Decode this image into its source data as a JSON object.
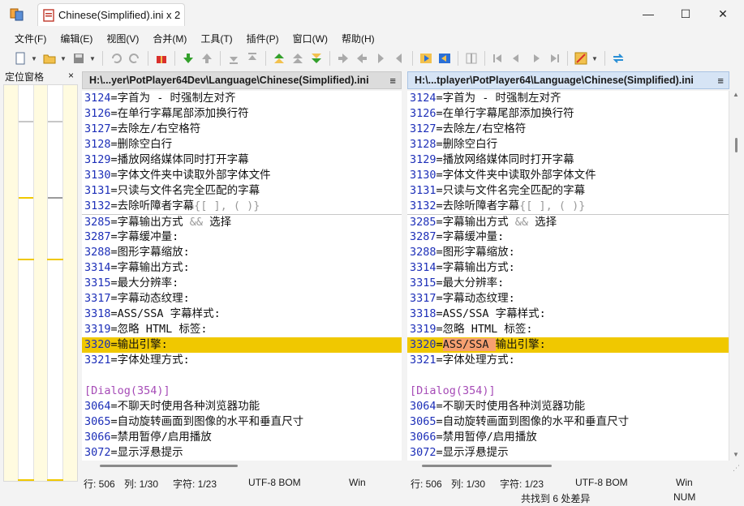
{
  "window": {
    "tab_title": "Chinese(Simplified).ini x 2",
    "minimize": "—",
    "maximize": "☐",
    "close": "✕"
  },
  "menu": [
    "文件(F)",
    "编辑(E)",
    "视图(V)",
    "合并(M)",
    "工具(T)",
    "插件(P)",
    "窗口(W)",
    "帮助(H)"
  ],
  "locator": {
    "title": "定位窗格",
    "close": "×",
    "accent_color": "#f0c800"
  },
  "left_pane": {
    "path": "H:\\...yer\\PotPlayer64Dev\\Language\\Chinese(Simplified).ini",
    "menu_glyph": "≡",
    "lines": [
      {
        "num": "3124",
        "text": "=字首为 - 时强制左对齐"
      },
      {
        "num": "3126",
        "text": "=在单行字幕尾部添加换行符"
      },
      {
        "num": "3127",
        "text": "=去除左/右空格符"
      },
      {
        "num": "3128",
        "text": "=删除空白行"
      },
      {
        "num": "3129",
        "text": "=播放网络媒体同时打开字幕"
      },
      {
        "num": "3130",
        "text": "=字体文件夹中读取外部字体文件"
      },
      {
        "num": "3131",
        "text": "=只读与文件名完全匹配的字幕"
      },
      {
        "num": "3132",
        "text": "=去除听障者字幕",
        "faint": "{[ ], ( )}"
      },
      {
        "num": "3285",
        "text": "=字幕输出方式 ",
        "faint": "&&",
        "tail": " 选择"
      },
      {
        "num": "3287",
        "text": "=字幕缓冲量:"
      },
      {
        "num": "3288",
        "text": "=图形字幕缩放:"
      },
      {
        "num": "3314",
        "text": "=字幕输出方式:"
      },
      {
        "num": "3315",
        "text": "=最大分辨率:"
      },
      {
        "num": "3317",
        "text": "=字幕动态纹理:"
      },
      {
        "num": "3318",
        "text": "=ASS/SSA 字幕样式:"
      },
      {
        "num": "3319",
        "text": "=忽略 HTML 标签:"
      },
      {
        "num": "3320",
        "text": "=输出引擎:"
      },
      {
        "num": "3321",
        "text": "=字体处理方式:"
      },
      {
        "num": "",
        "text": ""
      },
      {
        "num": "",
        "text": "[Dialog(354)]"
      },
      {
        "num": "3064",
        "text": "=不聊天时使用各种浏览器功能"
      },
      {
        "num": "3065",
        "text": "=自动旋转画面到图像的水平和垂直尺寸"
      },
      {
        "num": "3066",
        "text": "=禁用暂停/启用播放"
      },
      {
        "num": "3072",
        "text": "=显示浮悬提示"
      }
    ]
  },
  "right_pane": {
    "path": "H:\\...tplayer\\PotPlayer64\\Language\\Chinese(Simplified).ini",
    "menu_glyph": "≡",
    "lines": [
      {
        "num": "3124",
        "text": "=字首为 - 时强制左对齐"
      },
      {
        "num": "3126",
        "text": "=在单行字幕尾部添加换行符"
      },
      {
        "num": "3127",
        "text": "=去除左/右空格符"
      },
      {
        "num": "3128",
        "text": "=删除空白行"
      },
      {
        "num": "3129",
        "text": "=播放网络媒体同时打开字幕"
      },
      {
        "num": "3130",
        "text": "=字体文件夹中读取外部字体文件"
      },
      {
        "num": "3131",
        "text": "=只读与文件名完全匹配的字幕"
      },
      {
        "num": "3132",
        "text": "=去除听障者字幕",
        "faint": "{[ ], ( )}"
      },
      {
        "num": "3285",
        "text": "=字幕输出方式 ",
        "faint": "&&",
        "tail": " 选择"
      },
      {
        "num": "3287",
        "text": "=字幕缓冲量:"
      },
      {
        "num": "3288",
        "text": "=图形字幕缩放:"
      },
      {
        "num": "3314",
        "text": "=字幕输出方式:"
      },
      {
        "num": "3315",
        "text": "=最大分辨率:"
      },
      {
        "num": "3317",
        "text": "=字幕动态纹理:"
      },
      {
        "num": "3318",
        "text": "=ASS/SSA 字幕样式:"
      },
      {
        "num": "3319",
        "text": "=忽略 HTML 标签:"
      },
      {
        "num": "3320",
        "text": "=",
        "diff": "ASS/SSA ",
        "tail": "输出引擎:"
      },
      {
        "num": "3321",
        "text": "=字体处理方式:"
      },
      {
        "num": "",
        "text": ""
      },
      {
        "num": "",
        "text": "[Dialog(354)]"
      },
      {
        "num": "3064",
        "text": "=不聊天时使用各种浏览器功能"
      },
      {
        "num": "3065",
        "text": "=自动旋转画面到图像的水平和垂直尺寸"
      },
      {
        "num": "3066",
        "text": "=禁用暂停/启用播放"
      },
      {
        "num": "3072",
        "text": "=显示浮悬提示"
      }
    ]
  },
  "highlight_row_number": "3320",
  "status_left": {
    "row": "行: 506",
    "col": "列: 1/30",
    "chars": "字符: 1/23",
    "encoding": "UTF-8 BOM",
    "eol": "Win"
  },
  "status_right": {
    "row": "行: 506",
    "col": "列: 1/30",
    "chars": "字符: 1/23",
    "encoding": "UTF-8 BOM",
    "eol": "Win"
  },
  "footer": {
    "diff_count": "共找到 6 处差异",
    "num_lock": "NUM"
  }
}
